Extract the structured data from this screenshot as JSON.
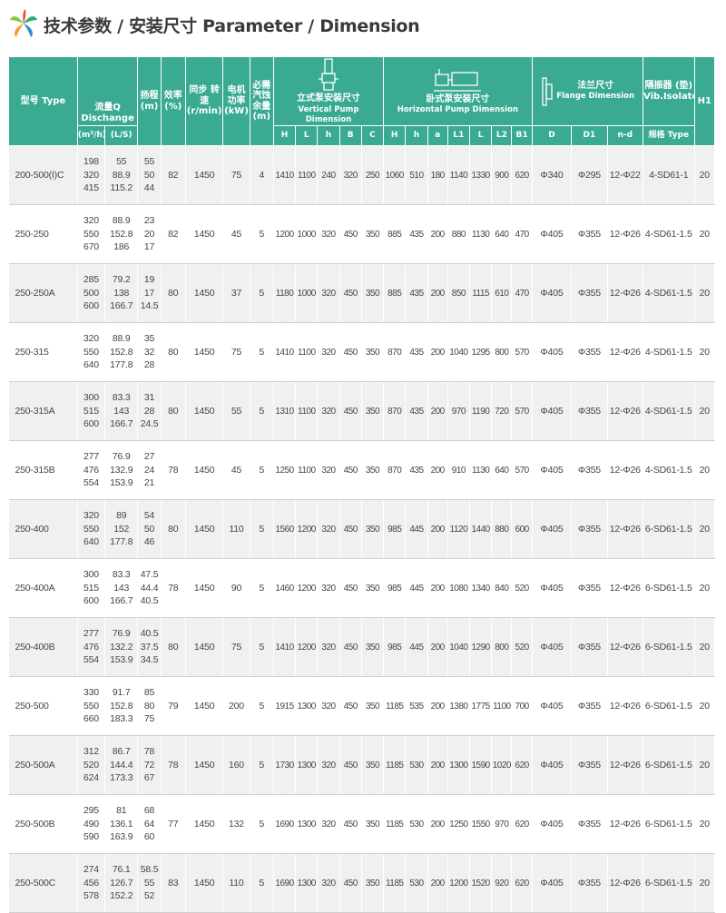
{
  "header": {
    "title": "技术参数 / 安装尺寸 Parameter / Dimension",
    "logo_icon": "green-leaf-logo-icon"
  },
  "colors": {
    "header_bg": "#3aaa93",
    "row_alt": "#f0f0f0"
  },
  "columns": {
    "model": "型号 Type",
    "discharge": "流量Q Dischange",
    "discharge_u1": "(m³/h)",
    "discharge_u2": "(L/S)",
    "head": "扬程 (m)",
    "efficiency": "效率 (%)",
    "speed": "同步 转速 (r/min)",
    "power": "电机 功率 (kW)",
    "npsh": "必需 汽蚀 余量 (m)",
    "vertical_group": "立式泵安装尺寸",
    "vertical_group_en": "Vertical Pump Dimension",
    "horizontal_group": "卧式泵安装尺寸",
    "horizontal_group_en": "Horizontal Pump Dimension",
    "flange_group": "法兰尺寸",
    "flange_group_en": "Flange Dimension",
    "isolator_group": "隔振器 (垫) Vib.Isolator",
    "h1": "H1",
    "v_sub": [
      "H",
      "L",
      "h",
      "B",
      "C"
    ],
    "h_sub": [
      "H",
      "h",
      "a",
      "L1",
      "L",
      "L2",
      "B1"
    ],
    "f_sub": [
      "D",
      "D1",
      "n-d"
    ],
    "iso_sub": "规格 Type"
  },
  "rows": [
    {
      "model": "200-500(I)C",
      "q1": [
        "198",
        "320",
        "415"
      ],
      "q2": [
        "55",
        "88.9",
        "115.2"
      ],
      "head": [
        "55",
        "50",
        "44"
      ],
      "eff": "82",
      "speed": "1450",
      "power": "75",
      "npsh": "4",
      "v": [
        "1410",
        "1100",
        "240",
        "320",
        "250"
      ],
      "h": [
        "1060",
        "510",
        "180",
        "1140",
        "1330",
        "900",
        "620"
      ],
      "f": [
        "Φ340",
        "Φ295",
        "12-Φ22"
      ],
      "iso": "4-SD61-1",
      "h1": "20"
    },
    {
      "model": "250-250",
      "q1": [
        "320",
        "550",
        "670"
      ],
      "q2": [
        "88.9",
        "152.8",
        "186"
      ],
      "head": [
        "23",
        "20",
        "17"
      ],
      "eff": "82",
      "speed": "1450",
      "power": "45",
      "npsh": "5",
      "v": [
        "1200",
        "1000",
        "320",
        "450",
        "350"
      ],
      "h": [
        "885",
        "435",
        "200",
        "880",
        "1130",
        "640",
        "470"
      ],
      "f": [
        "Φ405",
        "Φ355",
        "12-Φ26"
      ],
      "iso": "4-SD61-1.5",
      "h1": "20"
    },
    {
      "model": "250-250A",
      "q1": [
        "285",
        "500",
        "600"
      ],
      "q2": [
        "79.2",
        "138",
        "166.7"
      ],
      "head": [
        "19",
        "17",
        "14.5"
      ],
      "eff": "80",
      "speed": "1450",
      "power": "37",
      "npsh": "5",
      "v": [
        "1180",
        "1000",
        "320",
        "450",
        "350"
      ],
      "h": [
        "885",
        "435",
        "200",
        "850",
        "1115",
        "610",
        "470"
      ],
      "f": [
        "Φ405",
        "Φ355",
        "12-Φ26"
      ],
      "iso": "4-SD61-1.5",
      "h1": "20"
    },
    {
      "model": "250-315",
      "q1": [
        "320",
        "550",
        "640"
      ],
      "q2": [
        "88.9",
        "152.8",
        "177.8"
      ],
      "head": [
        "35",
        "32",
        "28"
      ],
      "eff": "80",
      "speed": "1450",
      "power": "75",
      "npsh": "5",
      "v": [
        "1410",
        "1100",
        "320",
        "450",
        "350"
      ],
      "h": [
        "870",
        "435",
        "200",
        "1040",
        "1295",
        "800",
        "570"
      ],
      "f": [
        "Φ405",
        "Φ355",
        "12-Φ26"
      ],
      "iso": "4-SD61-1.5",
      "h1": "20"
    },
    {
      "model": "250-315A",
      "q1": [
        "300",
        "515",
        "600"
      ],
      "q2": [
        "83.3",
        "143",
        "166.7"
      ],
      "head": [
        "31",
        "28",
        "24.5"
      ],
      "eff": "80",
      "speed": "1450",
      "power": "55",
      "npsh": "5",
      "v": [
        "1310",
        "1100",
        "320",
        "450",
        "350"
      ],
      "h": [
        "870",
        "435",
        "200",
        "970",
        "1190",
        "720",
        "570"
      ],
      "f": [
        "Φ405",
        "Φ355",
        "12-Φ26"
      ],
      "iso": "4-SD61-1.5",
      "h1": "20"
    },
    {
      "model": "250-315B",
      "q1": [
        "277",
        "476",
        "554"
      ],
      "q2": [
        "76.9",
        "132.9",
        "153.9"
      ],
      "head": [
        "27",
        "24",
        "21"
      ],
      "eff": "78",
      "speed": "1450",
      "power": "45",
      "npsh": "5",
      "v": [
        "1250",
        "1100",
        "320",
        "450",
        "350"
      ],
      "h": [
        "870",
        "435",
        "200",
        "910",
        "1130",
        "640",
        "570"
      ],
      "f": [
        "Φ405",
        "Φ355",
        "12-Φ26"
      ],
      "iso": "4-SD61-1.5",
      "h1": "20"
    },
    {
      "model": "250-400",
      "q1": [
        "320",
        "550",
        "640"
      ],
      "q2": [
        "89",
        "152",
        "177.8"
      ],
      "head": [
        "54",
        "50",
        "46"
      ],
      "eff": "80",
      "speed": "1450",
      "power": "110",
      "npsh": "5",
      "v": [
        "1560",
        "1200",
        "320",
        "450",
        "350"
      ],
      "h": [
        "985",
        "445",
        "200",
        "1120",
        "1440",
        "880",
        "600"
      ],
      "f": [
        "Φ405",
        "Φ355",
        "12-Φ26"
      ],
      "iso": "6-SD61-1.5",
      "h1": "20"
    },
    {
      "model": "250-400A",
      "q1": [
        "300",
        "515",
        "600"
      ],
      "q2": [
        "83.3",
        "143",
        "166.7"
      ],
      "head": [
        "47.5",
        "44.4",
        "40.5"
      ],
      "eff": "78",
      "speed": "1450",
      "power": "90",
      "npsh": "5",
      "v": [
        "1460",
        "1200",
        "320",
        "450",
        "350"
      ],
      "h": [
        "985",
        "445",
        "200",
        "1080",
        "1340",
        "840",
        "520"
      ],
      "f": [
        "Φ405",
        "Φ355",
        "12-Φ26"
      ],
      "iso": "6-SD61-1.5",
      "h1": "20"
    },
    {
      "model": "250-400B",
      "q1": [
        "277",
        "476",
        "554"
      ],
      "q2": [
        "76.9",
        "132.2",
        "153.9"
      ],
      "head": [
        "40.5",
        "37.5",
        "34.5"
      ],
      "eff": "80",
      "speed": "1450",
      "power": "75",
      "npsh": "5",
      "v": [
        "1410",
        "1200",
        "320",
        "450",
        "350"
      ],
      "h": [
        "985",
        "445",
        "200",
        "1040",
        "1290",
        "800",
        "520"
      ],
      "f": [
        "Φ405",
        "Φ355",
        "12-Φ26"
      ],
      "iso": "6-SD61-1.5",
      "h1": "20"
    },
    {
      "model": "250-500",
      "q1": [
        "330",
        "550",
        "660"
      ],
      "q2": [
        "91.7",
        "152.8",
        "183.3"
      ],
      "head": [
        "85",
        "80",
        "75"
      ],
      "eff": "79",
      "speed": "1450",
      "power": "200",
      "npsh": "5",
      "v": [
        "1915",
        "1300",
        "320",
        "450",
        "350"
      ],
      "h": [
        "1185",
        "535",
        "200",
        "1380",
        "1775",
        "1100",
        "700"
      ],
      "f": [
        "Φ405",
        "Φ355",
        "12-Φ26"
      ],
      "iso": "6-SD61-1.5",
      "h1": "20"
    },
    {
      "model": "250-500A",
      "q1": [
        "312",
        "520",
        "624"
      ],
      "q2": [
        "86.7",
        "144.4",
        "173.3"
      ],
      "head": [
        "78",
        "72",
        "67"
      ],
      "eff": "78",
      "speed": "1450",
      "power": "160",
      "npsh": "5",
      "v": [
        "1730",
        "1300",
        "320",
        "450",
        "350"
      ],
      "h": [
        "1185",
        "530",
        "200",
        "1300",
        "1590",
        "1020",
        "620"
      ],
      "f": [
        "Φ405",
        "Φ355",
        "12-Φ26"
      ],
      "iso": "6-SD61-1.5",
      "h1": "20"
    },
    {
      "model": "250-500B",
      "q1": [
        "295",
        "490",
        "590"
      ],
      "q2": [
        "81",
        "136.1",
        "163.9"
      ],
      "head": [
        "68",
        "64",
        "60"
      ],
      "eff": "77",
      "speed": "1450",
      "power": "132",
      "npsh": "5",
      "v": [
        "1690",
        "1300",
        "320",
        "450",
        "350"
      ],
      "h": [
        "1185",
        "530",
        "200",
        "1250",
        "1550",
        "970",
        "620"
      ],
      "f": [
        "Φ405",
        "Φ355",
        "12-Φ26"
      ],
      "iso": "6-SD61-1.5",
      "h1": "20"
    },
    {
      "model": "250-500C",
      "q1": [
        "274",
        "456",
        "578"
      ],
      "q2": [
        "76.1",
        "126.7",
        "152.2"
      ],
      "head": [
        "58.5",
        "55",
        "52"
      ],
      "eff": "83",
      "speed": "1450",
      "power": "110",
      "npsh": "5",
      "v": [
        "1690",
        "1300",
        "320",
        "450",
        "350"
      ],
      "h": [
        "1185",
        "530",
        "200",
        "1200",
        "1520",
        "920",
        "620"
      ],
      "f": [
        "Φ405",
        "Φ355",
        "12-Φ26"
      ],
      "iso": "6-SD61-1.5",
      "h1": "20"
    }
  ]
}
